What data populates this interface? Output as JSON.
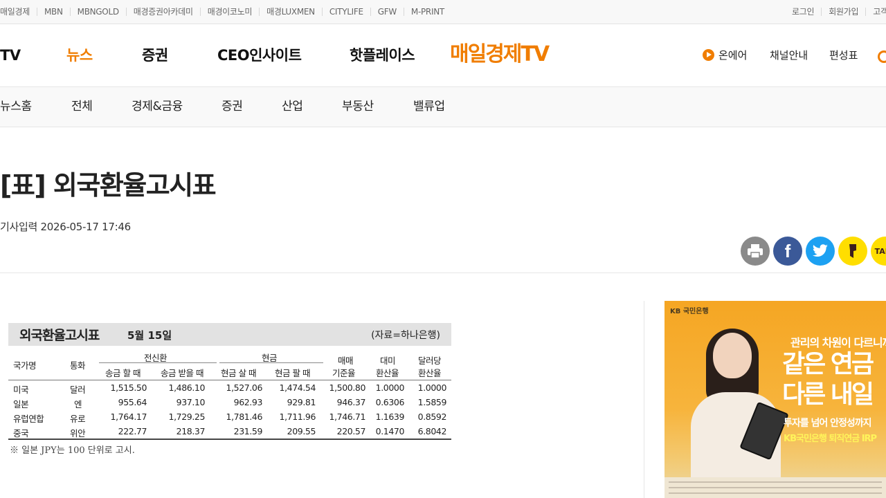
{
  "topbar": {
    "sites": [
      "매일경제",
      "MBN",
      "MBNGOLD",
      "매경증권아카데미",
      "매경이코노미",
      "매경LUXMEN",
      "CITYLIFE",
      "GFW",
      "M-PRINT"
    ],
    "util": [
      "로그인",
      "회원가입",
      "고객"
    ]
  },
  "gnb": {
    "menus": [
      "TV",
      "뉴스",
      "증권",
      "CEO인사이트",
      "핫플레이스"
    ],
    "active": "뉴스",
    "logo": "매일경제TV",
    "onair": "온에어",
    "channel": "채널안내",
    "schedule": "편성표"
  },
  "lnb": [
    "뉴스홈",
    "전체",
    "경제&금융",
    "증권",
    "산업",
    "부동산",
    "밸류업"
  ],
  "article": {
    "title": "[표] 외국환율고시표",
    "date": "기사입력 2026-05-17 17:46"
  },
  "share": {
    "talk_label": "TALK"
  },
  "rate_table": {
    "title": "외국환율고시표",
    "date": "5월 15일",
    "source": "(자료=하나은행)",
    "col_country": "국가명",
    "col_currency": "통화",
    "grp_wire": "전신환",
    "grp_cash": "현금",
    "col_send": "송금 할 때",
    "col_receive": "송금 받을 때",
    "col_cash_buy": "현금 살 때",
    "col_cash_sell": "현금 팔 때",
    "col_base_1": "매매",
    "col_base_2": "기준율",
    "col_usd_1": "대미",
    "col_usd_2": "환산율",
    "col_per_1": "달러당",
    "col_per_2": "환산율",
    "rows": [
      {
        "country": "미국",
        "currency": "달러",
        "send": "1,515.50",
        "receive": "1,486.10",
        "buy": "1,527.06",
        "sell": "1,474.54",
        "base": "1,500.80",
        "usd": "1.0000",
        "per": "1.0000"
      },
      {
        "country": "일본",
        "currency": "엔",
        "send": "955.64",
        "receive": "937.10",
        "buy": "962.93",
        "sell": "929.81",
        "base": "946.37",
        "usd": "0.6306",
        "per": "1.5859"
      },
      {
        "country": "유럽연합",
        "currency": "유로",
        "send": "1,764.17",
        "receive": "1,729.25",
        "buy": "1,781.46",
        "sell": "1,711.96",
        "base": "1,746.71",
        "usd": "1.1639",
        "per": "0.8592"
      },
      {
        "country": "중국",
        "currency": "위안",
        "send": "222.77",
        "receive": "218.37",
        "buy": "231.59",
        "sell": "209.55",
        "base": "220.57",
        "usd": "0.1470",
        "per": "6.8042"
      }
    ],
    "note": "※ 일본 JPY는 100 단위로 고시."
  },
  "ad": {
    "brand": "KB 국민은행",
    "line1": "관리의 차원이 다르니까",
    "line2": "같은 연금",
    "line3": "다른 내일",
    "line4": "투자를 넘어 안정성까지",
    "line5": "KB국민은행 퇴직연금 IRP"
  }
}
